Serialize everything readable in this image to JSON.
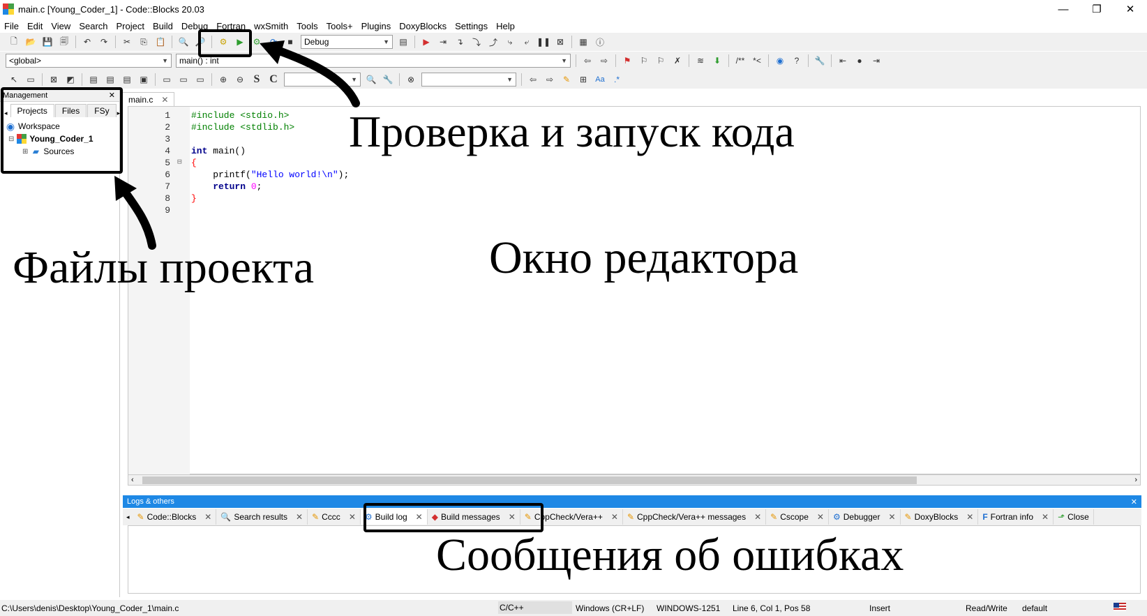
{
  "window": {
    "title": "main.c [Young_Coder_1] - Code::Blocks 20.03",
    "controls": [
      "—",
      "❐",
      "✕"
    ]
  },
  "menu": [
    "File",
    "Edit",
    "View",
    "Search",
    "Project",
    "Build",
    "Debug",
    "Fortran",
    "wxSmith",
    "Tools",
    "Tools+",
    "Plugins",
    "DoxyBlocks",
    "Settings",
    "Help"
  ],
  "toolbar": {
    "build_target": "Debug",
    "scope": "<global>",
    "function": "main() : int"
  },
  "management": {
    "title": "Management",
    "tabs": [
      "Projects",
      "Files",
      "FSy"
    ],
    "tree": {
      "workspace": "Workspace",
      "project": "Young_Coder_1",
      "sources": "Sources"
    }
  },
  "editor": {
    "tab": "main.c",
    "line_numbers": [
      "1",
      "2",
      "3",
      "4",
      "5",
      "6",
      "7",
      "8",
      "9"
    ]
  },
  "logs": {
    "title": "Logs & others",
    "tabs": [
      "Code::Blocks",
      "Search results",
      "Cccc",
      "Build log",
      "Build messages",
      "CppCheck/Vera++",
      "CppCheck/Vera++ messages",
      "Cscope",
      "Debugger",
      "DoxyBlocks",
      "Fortran info",
      "Close"
    ]
  },
  "status": {
    "path": "C:\\Users\\denis\\Desktop\\Young_Coder_1\\main.c",
    "lang": "C/C++",
    "eol": "Windows (CR+LF)",
    "encoding": "WINDOWS-1251",
    "position": "Line 6, Col 1, Pos 58",
    "mode": "Insert",
    "access": "Read/Write",
    "profile": "default"
  },
  "annotations": {
    "run": "Проверка и запуск кода",
    "files": "Файлы проекта",
    "editor": "Окно редактора",
    "errors": "Сообщения об ошибках"
  }
}
